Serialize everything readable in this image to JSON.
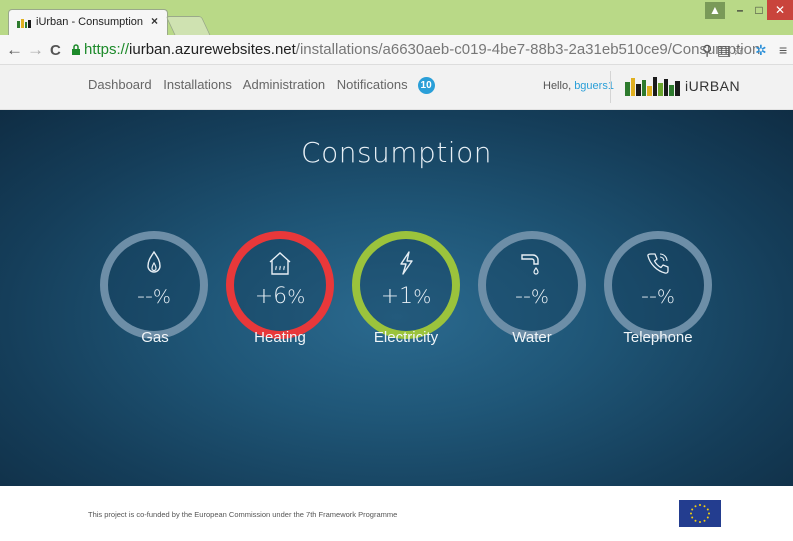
{
  "browser": {
    "tab_title": "iUrban - Consumption",
    "tab_close": "×",
    "url_scheme": "https://",
    "url_host": "iurban.azurewebsites.net",
    "url_path": "/installations/a6630aeb-c019-4be7-88b3-2a31eb510ce9/Consumption",
    "icons": [
      "back-icon",
      "forward-icon",
      "reload-icon",
      "lock-icon",
      "zoom-icon",
      "translate-icon",
      "bookmark-star-icon",
      "extension-icon",
      "menu-icon"
    ]
  },
  "header": {
    "nav": [
      {
        "label": "Dashboard"
      },
      {
        "label": "Installations"
      },
      {
        "label": "Administration"
      },
      {
        "label": "Notifications"
      }
    ],
    "notifications_count": "10",
    "hello_prefix": "Hello,",
    "username": "bguers1",
    "logo_text": "iURBAN"
  },
  "main": {
    "title": "Consumption",
    "gauges": [
      {
        "label": "Gas",
        "value": "--",
        "unit": "%",
        "icon": "flame-icon",
        "status_color": "#6d8ea7"
      },
      {
        "label": "Heating",
        "value": "+6",
        "unit": "%",
        "icon": "house-heating-icon",
        "status_color": "#e8383a"
      },
      {
        "label": "Electricity",
        "value": "+1",
        "unit": "%",
        "icon": "lightning-icon",
        "status_color": "#9bc33c"
      },
      {
        "label": "Water",
        "value": "--",
        "unit": "%",
        "icon": "faucet-icon",
        "status_color": "#6d8ea7"
      },
      {
        "label": "Telephone",
        "value": "--",
        "unit": "%",
        "icon": "phone-icon",
        "status_color": "#6d8ea7"
      }
    ]
  },
  "footer": {
    "text": "This project is co-funded by the European Commission under the 7th Framework Programme"
  },
  "colors": {
    "accent": "#2a9fd8",
    "hero_bg": "#1f5677",
    "chrome": "#b9d987"
  }
}
